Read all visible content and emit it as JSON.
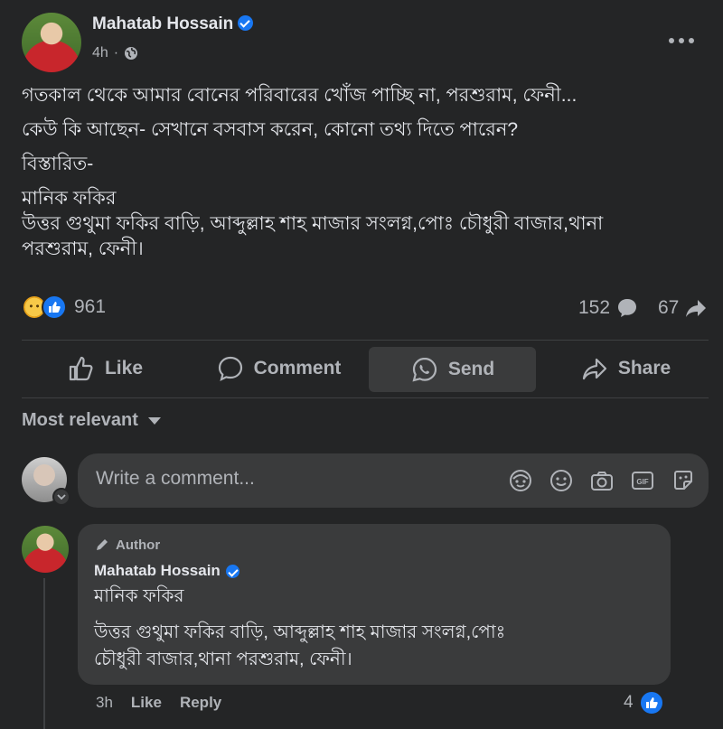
{
  "post": {
    "author": "Mahatab Hossain",
    "time": "4h",
    "paragraphs": [
      "গতকাল থেকে আমার বোনের পরিবারের খোঁজ পাচ্ছি না, পরশুরাম, ফেনী...",
      "কেউ কি আছেন- সেখানে বসবাস করেন, কোনো তথ্য দিতে পারেন?",
      "বিস্তারিত-"
    ],
    "address_line1": "মানিক ফকির",
    "address_line2": "উত্তর গুথুমা ফকির বাড়ি, আব্দুল্লাহ শাহ মাজার সংলগ্ন,পোঃ চৌধুরী বাজার,থানা",
    "address_line3": "পরশুরাম, ফেনী।"
  },
  "stats": {
    "reactions": "961",
    "comments": "152",
    "shares": "67"
  },
  "actions": {
    "like": "Like",
    "comment": "Comment",
    "send": "Send",
    "share": "Share"
  },
  "sort": {
    "label": "Most relevant"
  },
  "composer": {
    "placeholder": "Write a comment..."
  },
  "reply": {
    "badge": "Author",
    "author": "Mahatab Hossain",
    "line1": "মানিক ফকির",
    "line2": "উত্তর গুথুমা ফকির বাড়ি, আব্দুল্লাহ শাহ মাজার সংলগ্ন,পোঃ",
    "line3": "চৌধুরী বাজার,থানা পরশুরাম, ফেনী।",
    "time": "3h",
    "like": "Like",
    "reply": "Reply",
    "reactions": "4"
  },
  "colors": {
    "background": "#242526",
    "bubble": "#3a3b3c",
    "accent": "#1877f2",
    "text": "#e4e6eb",
    "muted": "#b0b3b8"
  }
}
